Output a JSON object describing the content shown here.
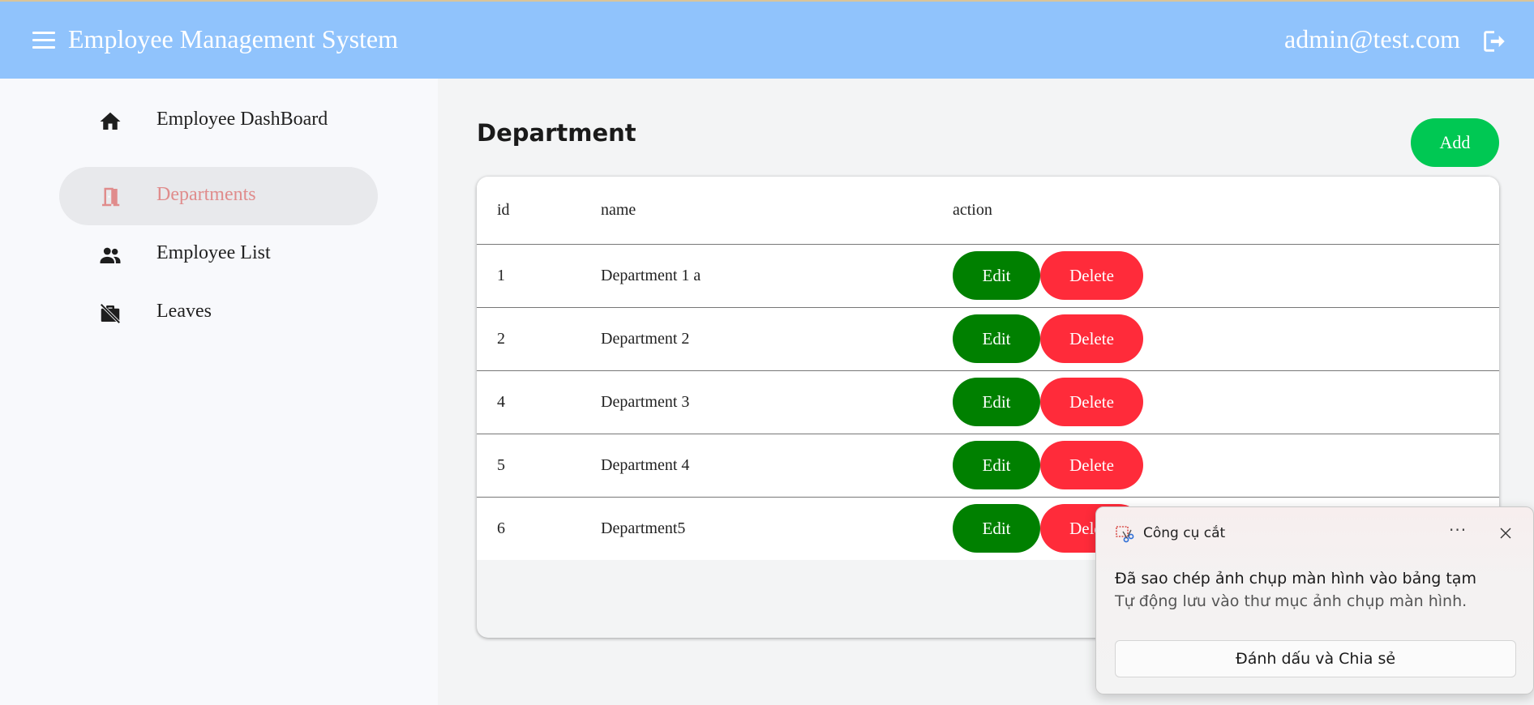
{
  "header": {
    "title": "Employee Management System",
    "user_email": "admin@test.com",
    "menu_icon": "hamburger-menu-icon",
    "logout_icon": "logout-icon",
    "background": "#90c3fc"
  },
  "sidebar": {
    "items": [
      {
        "label": "Employee DashBoard",
        "icon": "home-icon",
        "active": false
      },
      {
        "label": "Departments",
        "icon": "door-icon",
        "active": true
      },
      {
        "label": "Employee List",
        "icon": "people-icon",
        "active": false
      },
      {
        "label": "Leaves",
        "icon": "briefcase-off-icon",
        "active": false
      }
    ]
  },
  "main": {
    "title": "Department",
    "add_label": "Add",
    "table": {
      "headers": [
        "id",
        "name",
        "action"
      ],
      "rows": [
        {
          "id": "1",
          "name": "Department 1 a"
        },
        {
          "id": "2",
          "name": "Department 2"
        },
        {
          "id": "4",
          "name": "Department 3"
        },
        {
          "id": "5",
          "name": "Department 4"
        },
        {
          "id": "6",
          "name": "Department5"
        }
      ],
      "edit_label": "Edit",
      "delete_label": "Delete"
    }
  },
  "toast": {
    "app_name": "Công cụ cắt",
    "more_label": "···",
    "heading": "Đã sao chép ảnh chụp màn hình vào bảng tạm",
    "subtext": "Tự động lưu vào thư mục ảnh chụp màn hình.",
    "action_label": "Đánh dấu và Chia sẻ"
  },
  "colors": {
    "accent_add": "#00c853",
    "edit": "#008000",
    "delete": "#ff2b3a",
    "active_nav_text": "#e08c8c"
  }
}
